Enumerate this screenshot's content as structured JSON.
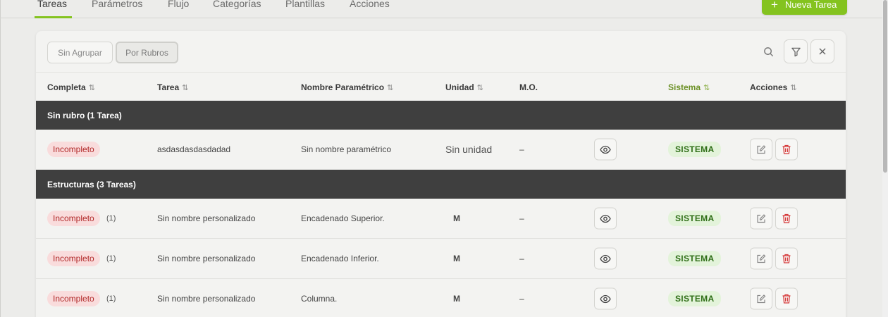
{
  "nav": {
    "tabs": [
      "Tareas",
      "Parámetros",
      "Flujo",
      "Categorías",
      "Plantillas",
      "Acciones"
    ],
    "new_button": "Nueva Tarea"
  },
  "toolbar": {
    "group_none": "Sin Agrupar",
    "group_by_rubro": "Por Rubros"
  },
  "columns": {
    "completa": "Completa",
    "tarea": "Tarea",
    "nombre_parametrico": "Nombre Paramétrico",
    "unidad": "Unidad",
    "mo": "M.O.",
    "sistema": "Sistema",
    "acciones": "Acciones",
    "sort_glyph": "⇅"
  },
  "groups": [
    {
      "title": "Sin rubro (1 Tarea)",
      "rows": [
        {
          "status": "Incompleto",
          "count": "",
          "tarea": "asdasdasdasdadad",
          "nombre": "Sin nombre paramétrico",
          "unidad": "Sin unidad",
          "mo": "–",
          "sistema": "SISTEMA"
        }
      ]
    },
    {
      "title": "Estructuras (3 Tareas)",
      "rows": [
        {
          "status": "Incompleto",
          "count": "(1)",
          "tarea": "Sin nombre personalizado",
          "nombre": "Encadenado Superior.",
          "unidad": "M",
          "mo": "–",
          "sistema": "SISTEMA"
        },
        {
          "status": "Incompleto",
          "count": "(1)",
          "tarea": "Sin nombre personalizado",
          "nombre": "Encadenado Inferior.",
          "unidad": "M",
          "mo": "–",
          "sistema": "SISTEMA"
        },
        {
          "status": "Incompleto",
          "count": "(1)",
          "tarea": "Sin nombre personalizado",
          "nombre": "Columna.",
          "unidad": "M",
          "mo": "–",
          "sistema": "SISTEMA"
        }
      ]
    }
  ],
  "colors": {
    "accent": "#84c31f",
    "group_header": "#3f3f3f",
    "incomplete_bg": "#f9dcdc",
    "incomplete_text": "#b22a2a",
    "system_bg": "#e3f3da",
    "system_text": "#2e6e16",
    "delete_icon": "#d63a3a"
  },
  "icons": [
    "plus-icon",
    "search-icon",
    "filter-icon",
    "close-icon",
    "eye-icon",
    "edit-icon",
    "trash-icon"
  ]
}
